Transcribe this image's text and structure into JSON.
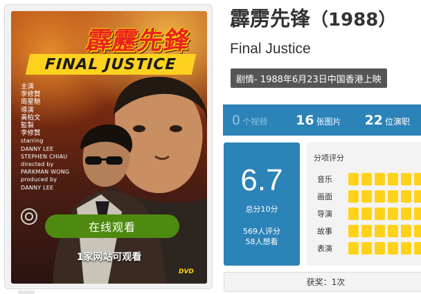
{
  "poster": {
    "title_cn": "霹靂先鋒",
    "title_en": "FINAL JUSTICE",
    "credits": [
      "主演",
      "李修賢",
      "周星馳",
      "導演",
      "黃柏文",
      "監製",
      "李修賢",
      "starring",
      "DANNY LEE",
      "STEPHEN CHIAU",
      "directed by",
      "PARKMAN WONG",
      "produced by",
      "DANNY LEE"
    ],
    "watch_label": "在线观看",
    "sites_text": "1家网站可观看",
    "dvd_logo": "DVD"
  },
  "movie": {
    "title": "霹雳先锋",
    "year": "（1988）",
    "original_title": "Final Justice",
    "tag": "剧情- 1988年6月23日中国香港上映"
  },
  "stats": [
    {
      "num": "0",
      "label": "个视频"
    },
    {
      "num": "16",
      "label": "张图片"
    },
    {
      "num": "22",
      "label": "位演职"
    }
  ],
  "score": {
    "value": "6.7",
    "scale": "总分10分",
    "raters": "569人评分",
    "wants": "58人想看"
  },
  "breakdown": {
    "title": "分项评分",
    "rows": [
      {
        "label": "音乐",
        "level": 6
      },
      {
        "label": "画面",
        "level": 6
      },
      {
        "label": "导演",
        "level": 6
      },
      {
        "label": "故事",
        "level": 6
      },
      {
        "label": "表演",
        "level": 6
      }
    ]
  },
  "awards": "获奖：1次",
  "colors": {
    "accent": "#2b83b8",
    "watch_button": "#4f8a10",
    "bar": "#ffd21a",
    "tag": "#555555"
  }
}
